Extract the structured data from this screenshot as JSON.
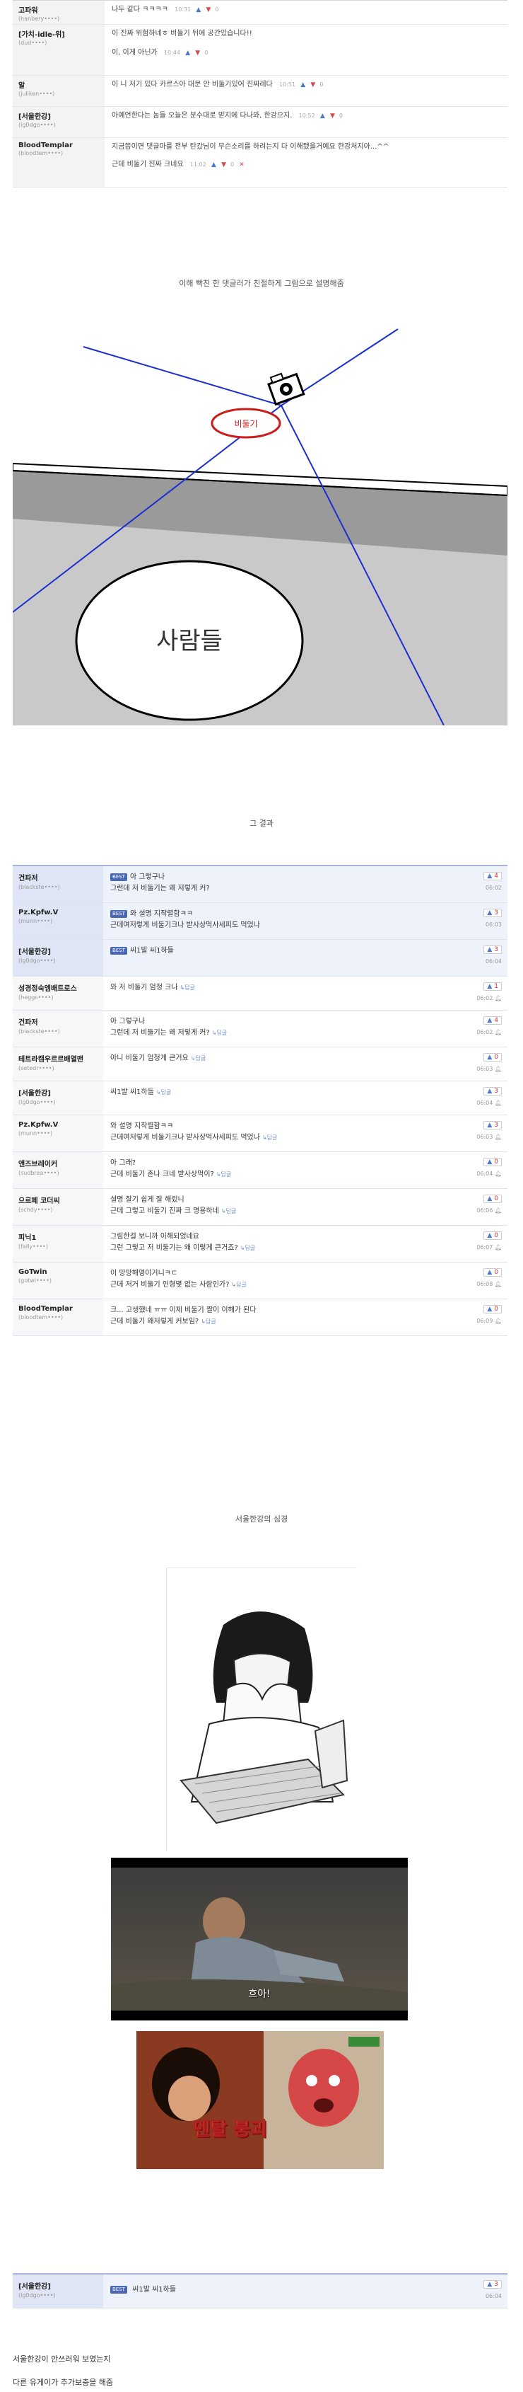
{
  "top_comments": [
    {
      "nick": "고파워",
      "uid": "(hanbery••••)",
      "text": "나두 같다 ㅋㅋㅋㅋ",
      "time": "10:31",
      "up": "",
      "down": "0"
    },
    {
      "nick": "[가치-idle-위]",
      "uid": "(dud••••)",
      "text": "이 진짜 위험하네ㅎ 비둘기 뒤에 공간있습니다!!",
      "text2": "이, 이게 아닌가",
      "time": "10:44",
      "up": "",
      "down": "0"
    },
    {
      "nick": "알",
      "uid": "(juliken••••)",
      "text": "이 니 저기 있다 카르스아 대문 안 비둘기있어 진짜레다",
      "time": "10:51",
      "up": "",
      "down": "0"
    },
    {
      "nick": "[서울한강]",
      "uid": "(lg0dgo••••)",
      "text": "아예언한다는 놈들 오늘은 분수대로 받지에 다나와, 한강으지.",
      "text2": "",
      "time": "10:52",
      "up": "",
      "down": "0"
    },
    {
      "nick": "BloodTemplar",
      "uid": "(bloodtem••••)",
      "text": "지금쯤이면 댓글마를 전부 탄갔님이 무슨소리를 하려는지 다 이해됐을거예요 한강처지아...^^",
      "text2": "근데 비둘기 진짜 크네요",
      "time": "11:02",
      "up": "",
      "down": "0"
    }
  ],
  "caption1": "이해 빡친 한 댓글러가 친절하게 그림으로 설명해줌",
  "diagram": {
    "bird_label": "비둘기",
    "person_label": "사람들"
  },
  "caption2": "그 결과",
  "comments2": [
    {
      "nick": "건파저",
      "uid": "(blackste••••)",
      "best": true,
      "text": "아 그렇구나",
      "text2": "그런데 저 비둘기는 왜 저렇게 커?",
      "up": "4",
      "time": "06:02"
    },
    {
      "nick": "Pz.Kpfw.V",
      "uid": "(munn••••)",
      "best": true,
      "text": "와 설명 지작렬함ㅋㅋ",
      "text2": "근데여저렇게 비둘기크나 받사상먹사세피도 먹었나",
      "up": "3",
      "time": "06:03"
    },
    {
      "nick": "[서울한강]",
      "uid": "(lg0dgo••••)",
      "best": true,
      "text": "씨1발 씨1하들",
      "text2": "",
      "up": "3",
      "time": "06:04"
    },
    {
      "nick": "성경정숙엠배트로스",
      "uid": "(heggs••••)",
      "best": false,
      "text": "와 저 비둘기 엄청 크나",
      "text2": "",
      "up": "1",
      "time": "06:02"
    },
    {
      "nick": "건파저",
      "uid": "(blackste••••)",
      "best": false,
      "text": "아 그렇구나",
      "text2": "그런데 저 비둘기는 왜 저렇게 커?",
      "up": "4",
      "time": "06:02"
    },
    {
      "nick": "테트라캠우르르배열맨",
      "uid": "(setedr••••)",
      "best": false,
      "text": "아니 비둘기 엄청게 큰거요",
      "text2": "",
      "up": "0",
      "time": "06:03"
    },
    {
      "nick": "[서울한강]",
      "uid": "(lg0dgo••••)",
      "best": false,
      "text": "씨1발 씨1하들",
      "text2": "",
      "up": "3",
      "time": "06:04"
    },
    {
      "nick": "Pz.Kpfw.V",
      "uid": "(munn••••)",
      "best": false,
      "text": "와 설명 지작렬함ㅋㅋ",
      "text2": "근데여저렇게 비둘기크나 받사상먹사세피도 먹었나",
      "up": "3",
      "time": "06:03"
    },
    {
      "nick": "앤즈브레이커",
      "uid": "(sudbrea••••)",
      "best": false,
      "text": "아 그래?",
      "text2": "근데 비둘기 존나 크네 받사상먹이?",
      "up": "0",
      "time": "06:04"
    },
    {
      "nick": "으르페 코더씨",
      "uid": "(schdy••••)",
      "best": false,
      "text": "설명 잘기 쉽게 잘 해렀니",
      "text2": "근데 그렇고 비둘기 진짜 크 명용하네",
      "up": "0",
      "time": "06:06"
    },
    {
      "nick": "피닉1",
      "uid": "(fally••••)",
      "best": false,
      "text": "그림한걸 보니까 이해되었네요",
      "text2": "그런 그렇고 저 비둘기는 왜 이렇게 큰거죠?",
      "up": "0",
      "time": "06:07"
    },
    {
      "nick": "GoTwin",
      "uid": "(gotwi••••)",
      "best": false,
      "text": "이 망망해영이거니ㅋㄷ",
      "text2": "근데 저거 비둘기 인형몇 없는 사람인가?",
      "up": "0",
      "time": "06:08"
    },
    {
      "nick": "BloodTemplar",
      "uid": "(bloodtem••••)",
      "best": false,
      "text": "크... 고생했네 ㅠㅠ 이제 비둘기 짤이 이해가 된다",
      "text2": "근데 비둘기 왜저렇게 커보임?",
      "up": "0",
      "time": "06:09"
    }
  ],
  "caption3": "서울한강의 심경",
  "photo1_sub": "흐아!",
  "photo2_sub": "멘탈 붕괴",
  "final_comment": {
    "nick": "[서울한강]",
    "uid": "(lg0dgo••••)",
    "text": "씨1발 씨1하들",
    "up": "3",
    "time": "06:04"
  },
  "bottom1": "서울한강이 안쓰러워 보였는지",
  "bottom2": "다른 유게이가 추가보충을 해줌",
  "colors": {
    "best_tag": "#4a67b3",
    "line_blue": "#1a2fd0",
    "bird_circle": "#cc1b1b"
  }
}
